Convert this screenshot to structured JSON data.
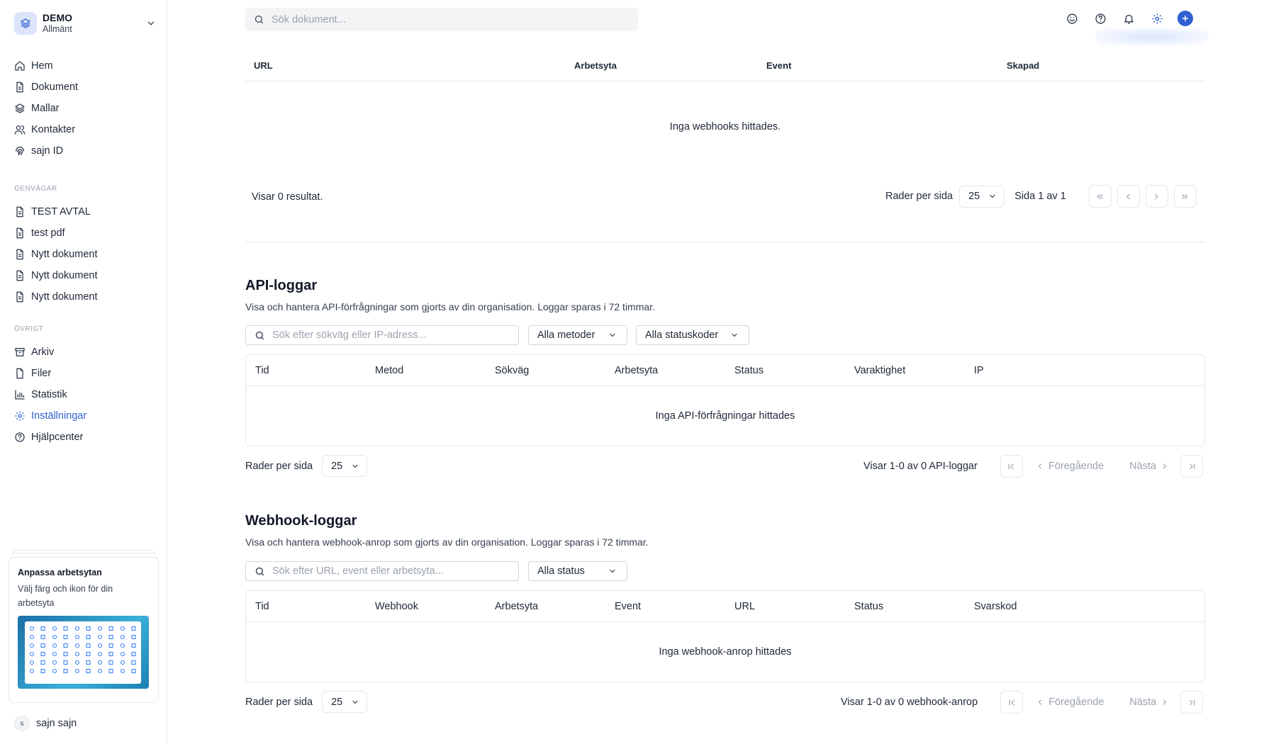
{
  "workspace": {
    "name": "DEMO",
    "subtitle": "Allmänt"
  },
  "nav": {
    "main": [
      {
        "label": "Hem",
        "icon": "home-icon"
      },
      {
        "label": "Dokument",
        "icon": "document-icon"
      },
      {
        "label": "Mallar",
        "icon": "layers-icon"
      },
      {
        "label": "Kontakter",
        "icon": "users-icon"
      },
      {
        "label": "sajn ID",
        "icon": "fingerprint-icon"
      }
    ],
    "shortcuts_heading": "GENVÄGAR",
    "shortcuts": [
      {
        "label": "TEST AVTAL"
      },
      {
        "label": "test pdf"
      },
      {
        "label": "Nytt dokument"
      },
      {
        "label": "Nytt dokument"
      },
      {
        "label": "Nytt dokument"
      }
    ],
    "other_heading": "ÖVRIGT",
    "other": [
      {
        "label": "Arkiv",
        "icon": "archive-icon"
      },
      {
        "label": "Filer",
        "icon": "file-icon"
      },
      {
        "label": "Statistik",
        "icon": "bar-chart-icon"
      },
      {
        "label": "Inställningar",
        "icon": "gear-icon",
        "active": true
      },
      {
        "label": "Hjälpcenter",
        "icon": "help-circle-icon"
      }
    ]
  },
  "promo": {
    "title": "Anpassa arbetsytan",
    "text": "Välj färg och ikon för din arbetsyta"
  },
  "user": {
    "initial": "s",
    "name": "sajn sajn"
  },
  "search": {
    "placeholder": "Sök dokument..."
  },
  "colors": {
    "accent": "#2f5fd0",
    "border": "#e5e7eb",
    "muted": "#9ca3af"
  },
  "webhooks": {
    "columns": [
      "URL",
      "Arbetsyta",
      "Event",
      "Skapad"
    ],
    "empty": "Inga webhooks hittades.",
    "results": "Visar 0 resultat.",
    "rows_label": "Rader per sida",
    "rows_value": "25",
    "page_info": "Sida 1 av 1"
  },
  "api_logs": {
    "title": "API-loggar",
    "description": "Visa och hantera API-förfrågningar som gjorts av din organisation. Loggar sparas i 72 timmar.",
    "search_placeholder": "Sök efter sökväg eller IP-adress...",
    "method_filter": "Alla metoder",
    "status_filter": "Alla statuskoder",
    "columns": [
      "Tid",
      "Metod",
      "Sökväg",
      "Arbetsyta",
      "Status",
      "Varaktighet",
      "IP"
    ],
    "empty": "Inga API-förfrågningar hittades",
    "rows_label": "Rader per sida",
    "rows_value": "25",
    "summary": "Visar 1-0 av 0 API-loggar",
    "prev": "Föregående",
    "next": "Nästa"
  },
  "webhook_logs": {
    "title": "Webhook-loggar",
    "description": "Visa och hantera webhook-anrop som gjorts av din organisation. Loggar sparas i 72 timmar.",
    "search_placeholder": "Sök efter URL, event eller arbetsyta...",
    "status_filter": "Alla status",
    "columns": [
      "Tid",
      "Webhook",
      "Arbetsyta",
      "Event",
      "URL",
      "Status",
      "Svarskod"
    ],
    "empty": "Inga webhook-anrop hittades",
    "rows_label": "Rader per sida",
    "rows_value": "25",
    "summary": "Visar 1-0 av 0 webhook-anrop",
    "prev": "Föregående",
    "next": "Nästa"
  }
}
